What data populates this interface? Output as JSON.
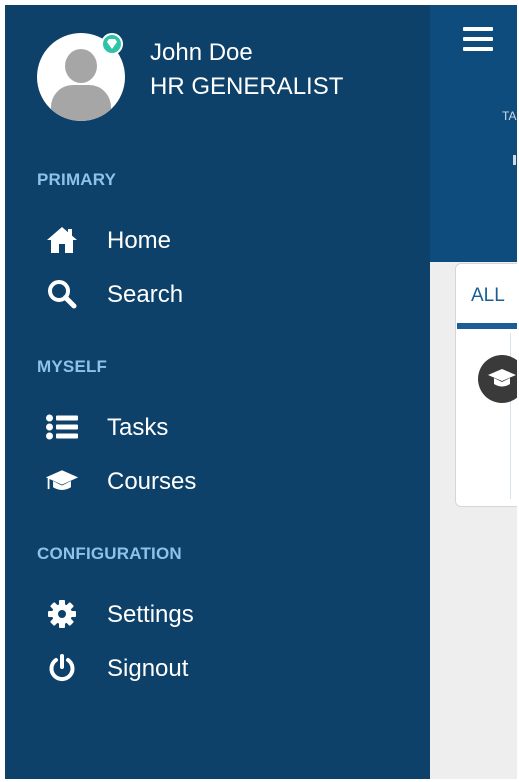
{
  "user": {
    "name": "John Doe",
    "role": "HR GENERALIST"
  },
  "sections": [
    {
      "title": "PRIMARY",
      "items": [
        {
          "label": "Home",
          "icon": "home-icon"
        },
        {
          "label": "Search",
          "icon": "search-icon"
        }
      ]
    },
    {
      "title": "MYSELF",
      "items": [
        {
          "label": "Tasks",
          "icon": "list-icon"
        },
        {
          "label": "Courses",
          "icon": "graduation-cap-icon"
        }
      ]
    },
    {
      "title": "CONFIGURATION",
      "items": [
        {
          "label": "Settings",
          "icon": "gear-icon"
        },
        {
          "label": "Signout",
          "icon": "power-icon"
        }
      ]
    }
  ],
  "main": {
    "header_text": "TA",
    "tab_label": "ALL"
  },
  "colors": {
    "sidebar_bg": "#0d4169",
    "header_bg": "#0f4c7e",
    "section_title": "#8ec2ea",
    "status_dot": "#2fc3a7",
    "accent": "#1a5e95"
  }
}
